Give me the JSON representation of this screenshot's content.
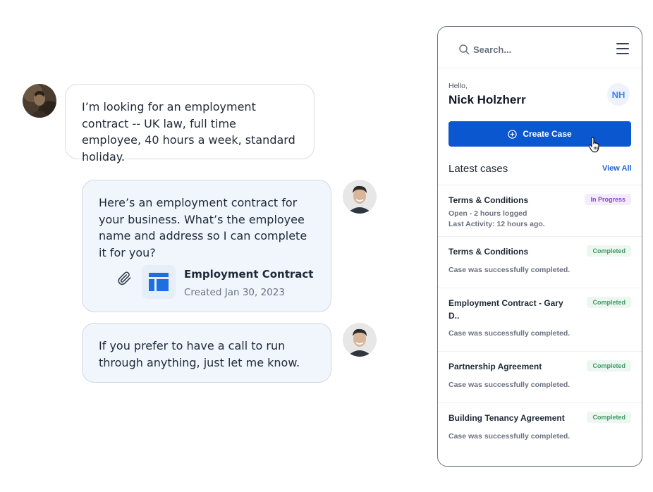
{
  "chat": {
    "user_message": "I’m looking for an employment contract -- UK law, full time employee, 40 hours a week, standard holiday.",
    "agent_message_1": "Here’s an employment contract for your business. What’s the employee name and address so I can complete it for you?",
    "attachment": {
      "title": "Employment Contract",
      "subtitle": "Created Jan 30, 2023"
    },
    "agent_message_2": "If you prefer to have a call to run through anything, just let me know."
  },
  "panel": {
    "search": {
      "placeholder": "Search..."
    },
    "greeting": "Hello,",
    "user_name": "Nick Holzherr",
    "initials": "NH",
    "create_button_label": "Create Case",
    "latest_title": "Latest cases",
    "view_all_label": "View All",
    "cases": [
      {
        "title": "Terms & Conditions",
        "status": "In Progress",
        "line1": "Open - 2 hours logged",
        "line2": "Last Activity: 12 hours ago."
      },
      {
        "title": "Terms & Conditions",
        "status": "Completed",
        "line1": "Case was successfully completed."
      },
      {
        "title": "Employment Contract - Gary D..",
        "status": "Completed",
        "line1": "Case was successfully completed."
      },
      {
        "title": "Partnership Agreement",
        "status": "Completed",
        "line1": "Case was successfully completed."
      },
      {
        "title": "Building Tenancy Agreement",
        "status": "Completed",
        "line1": "Case was successfully completed."
      }
    ]
  },
  "colors": {
    "primary": "#0b57d0",
    "link": "#1d5fd6",
    "agent_bubble": "#f1f6fd",
    "in_progress": "#8b45c9",
    "completed": "#3f9a66"
  }
}
